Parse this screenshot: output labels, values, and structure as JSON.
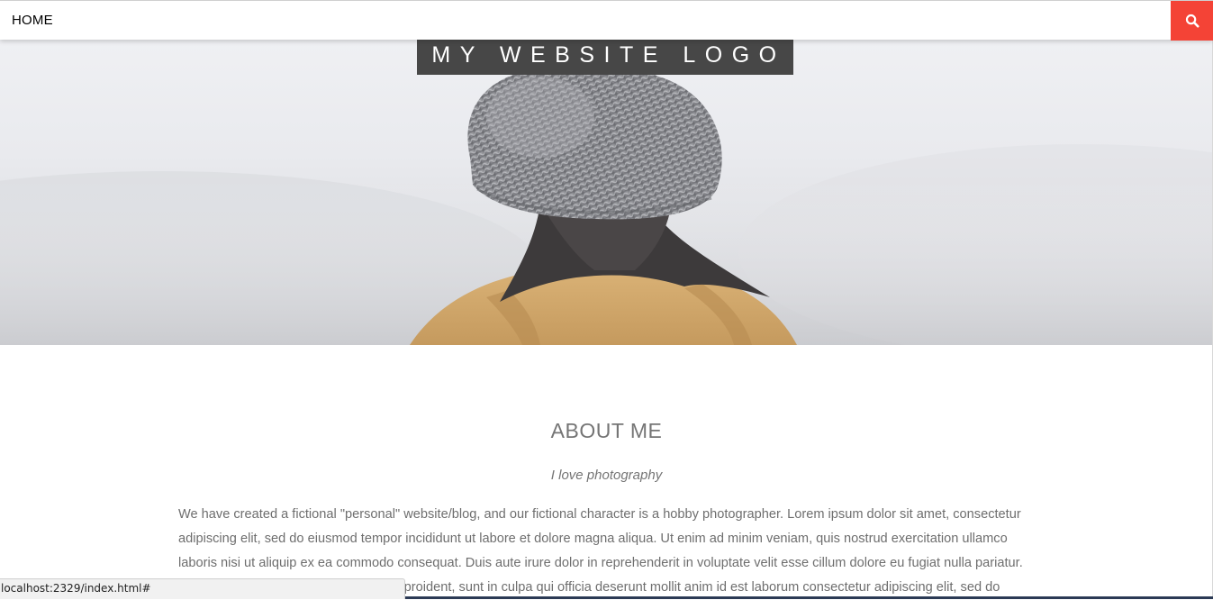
{
  "nav": {
    "home_label": "HOME",
    "search_icon": "search-icon",
    "accent_color": "#f44336"
  },
  "hero": {
    "logo_text": "MY WEBSITE LOGO",
    "image": "person-in-knit-beanie-photo"
  },
  "about": {
    "title": "ABOUT ME",
    "subtitle": "I love photography",
    "body": "We have created a fictional \"personal\" website/blog, and our fictional character is a hobby photographer. Lorem ipsum dolor sit amet, consectetur adipiscing elit, sed do eiusmod tempor incididunt ut labore et dolore magna aliqua. Ut enim ad minim veniam, quis nostrud exercitation ullamco laboris nisi ut aliquip ex ea commodo consequat. Duis aute irure dolor in reprehenderit in voluptate velit esse cillum dolore eu fugiat nulla pariatur. Excepteur sint occaecat cupidatat non proident, sunt in culpa qui officia deserunt mollit anim id est laborum consectetur adipiscing elit, sed do"
  },
  "statusbar": {
    "url": "localhost:2329/index.html#"
  }
}
